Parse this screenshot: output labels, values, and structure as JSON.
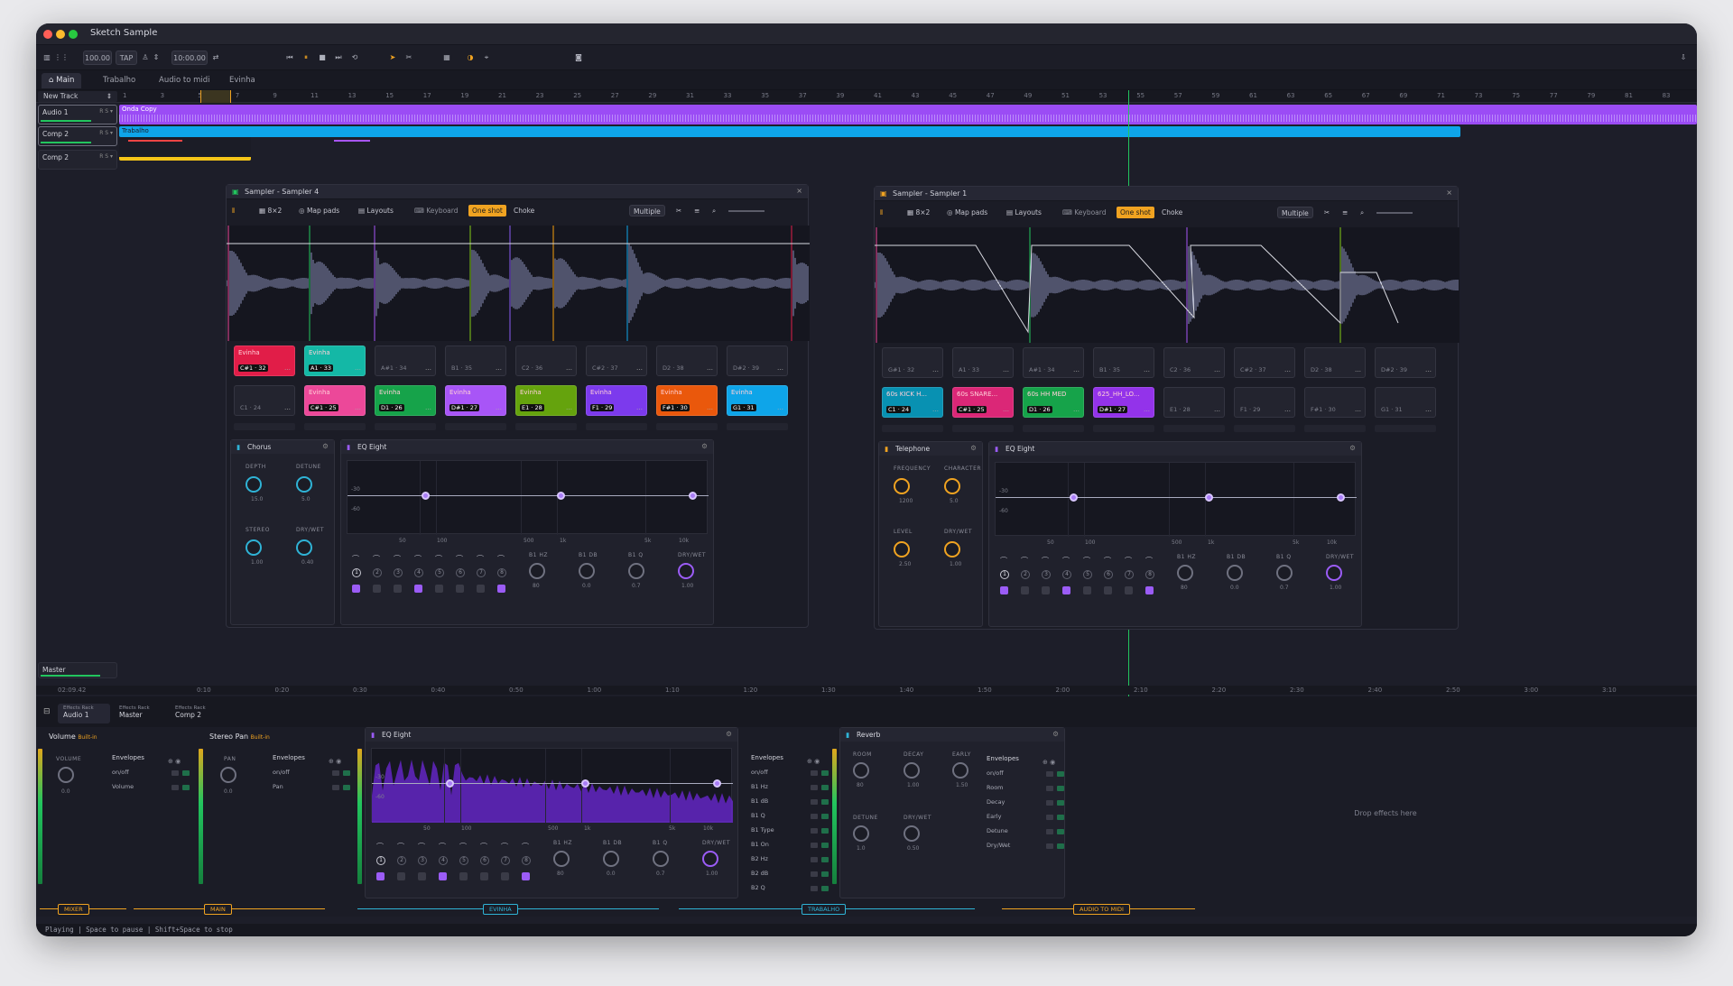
{
  "app_title": "Sketch Sample",
  "toolbar": {
    "bpm": "100.00",
    "tap": "TAP",
    "time": "10:00.00"
  },
  "tabs": [
    "Main",
    "Trabalho",
    "Audio to midi",
    "Evinha"
  ],
  "new_track": "New Track",
  "ruler_numbers": [
    "1",
    "3",
    "5",
    "7",
    "9",
    "11",
    "13",
    "15",
    "17",
    "19",
    "21",
    "23",
    "25",
    "27",
    "29",
    "31",
    "33",
    "35",
    "37",
    "39",
    "41",
    "43",
    "45",
    "47",
    "49",
    "51",
    "53",
    "55",
    "57",
    "59",
    "61",
    "63",
    "65",
    "67",
    "69",
    "71",
    "73",
    "75",
    "77",
    "79",
    "81",
    "83"
  ],
  "tracks": [
    {
      "name": "Audio 1",
      "clip": "Onda Copy",
      "color": "#a855f7"
    },
    {
      "name": "Comp 2",
      "clip": "Trabalho",
      "color": "#0ea5e9"
    },
    {
      "name": "Comp 2",
      "clip": "Audio to midi",
      "color": "#f5c518"
    }
  ],
  "master_track": "Master",
  "sampler_left": {
    "title": "Sampler - Sampler 4",
    "toolbar": {
      "grid": "8×2",
      "map_pads": "Map pads",
      "layouts": "Layouts",
      "keyboard": "Keyboard",
      "one_shot": "One shot",
      "choke": "Choke",
      "multiple": "Multiple"
    },
    "pads_top": [
      {
        "name": "Evinha",
        "note": "C#1 · 32",
        "color": "#e11d48"
      },
      {
        "name": "Evinha",
        "note": "A1 · 33",
        "color": "#14b8a6"
      },
      {
        "name": "",
        "note": "A#1 · 34",
        "color": ""
      },
      {
        "name": "",
        "note": "B1 · 35",
        "color": ""
      },
      {
        "name": "",
        "note": "C2 · 36",
        "color": ""
      },
      {
        "name": "",
        "note": "C#2 · 37",
        "color": ""
      },
      {
        "name": "",
        "note": "D2 · 38",
        "color": ""
      },
      {
        "name": "",
        "note": "D#2 · 39",
        "color": ""
      }
    ],
    "pads_bottom": [
      {
        "name": "",
        "note": "C1 · 24",
        "color": ""
      },
      {
        "name": "Evinha",
        "note": "C#1 · 25",
        "color": "#ec4899"
      },
      {
        "name": "Evinha",
        "note": "D1 · 26",
        "color": "#16a34a"
      },
      {
        "name": "Evinha",
        "note": "D#1 · 27",
        "color": "#a855f7"
      },
      {
        "name": "Evinha",
        "note": "E1 · 28",
        "color": "#65a30d"
      },
      {
        "name": "Evinha",
        "note": "F1 · 29",
        "color": "#7c3aed"
      },
      {
        "name": "Evinha",
        "note": "F#1 · 30",
        "color": "#ea580c"
      },
      {
        "name": "Evinha",
        "note": "G1 · 31",
        "color": "#0ea5e9"
      }
    ],
    "fx1": {
      "name": "Chorus",
      "knobs": [
        {
          "label": "DEPTH",
          "value": "15.0"
        },
        {
          "label": "DETUNE",
          "value": "5.0"
        },
        {
          "label": "STEREO",
          "value": "1.00"
        },
        {
          "label": "DRY/WET",
          "value": "0.40"
        }
      ]
    },
    "fx2": {
      "name": "EQ Eight"
    }
  },
  "sampler_right": {
    "title": "Sampler - Sampler 1",
    "toolbar": {
      "grid": "8×2",
      "map_pads": "Map pads",
      "layouts": "Layouts",
      "keyboard": "Keyboard",
      "one_shot": "One shot",
      "choke": "Choke",
      "multiple": "Multiple"
    },
    "pads_top": [
      {
        "name": "",
        "note": "G#1 · 32",
        "color": ""
      },
      {
        "name": "",
        "note": "A1 · 33",
        "color": ""
      },
      {
        "name": "",
        "note": "A#1 · 34",
        "color": ""
      },
      {
        "name": "",
        "note": "B1 · 35",
        "color": ""
      },
      {
        "name": "",
        "note": "C2 · 36",
        "color": ""
      },
      {
        "name": "",
        "note": "C#2 · 37",
        "color": ""
      },
      {
        "name": "",
        "note": "D2 · 38",
        "color": ""
      },
      {
        "name": "",
        "note": "D#2 · 39",
        "color": ""
      }
    ],
    "pads_bottom": [
      {
        "name": "60s KICK H...",
        "note": "C1 · 24",
        "color": "#0891b2"
      },
      {
        "name": "60s SNARE...",
        "note": "C#1 · 25",
        "color": "#db2777"
      },
      {
        "name": "60s HH MED",
        "note": "D1 · 26",
        "color": "#16a34a"
      },
      {
        "name": "625_HH_LO...",
        "note": "D#1 · 27",
        "color": "#9333ea"
      },
      {
        "name": "",
        "note": "E1 · 28",
        "color": ""
      },
      {
        "name": "",
        "note": "F1 · 29",
        "color": ""
      },
      {
        "name": "",
        "note": "F#1 · 30",
        "color": ""
      },
      {
        "name": "",
        "note": "G1 · 31",
        "color": ""
      }
    ],
    "fx1": {
      "name": "Telephone",
      "knobs": [
        {
          "label": "FREQUENCY",
          "value": "1200"
        },
        {
          "label": "CHARACTER",
          "value": "5.0"
        },
        {
          "label": "LEVEL",
          "value": "2.50"
        },
        {
          "label": "DRY/WET",
          "value": "1.00"
        }
      ]
    },
    "fx2": {
      "name": "EQ Eight"
    }
  },
  "eq": {
    "db_labels": [
      "-30",
      "-60"
    ],
    "freq_labels": [
      "50",
      "100",
      "500",
      "1k",
      "5k",
      "10k"
    ],
    "knobs": [
      {
        "label": "B1 HZ",
        "value": "80"
      },
      {
        "label": "B1 DB",
        "value": "0.0"
      },
      {
        "label": "B1 Q",
        "value": "0.7"
      },
      {
        "label": "DRY/WET",
        "value": "1.00"
      }
    ],
    "bands": [
      "1",
      "2",
      "3",
      "4",
      "5",
      "6",
      "7",
      "8"
    ],
    "bands_on": [
      true,
      false,
      false,
      true,
      false,
      false,
      false,
      true
    ]
  },
  "arrangement_time": "02:09.42",
  "time_ruler": [
    "0:10",
    "0:20",
    "0:30",
    "0:40",
    "0:50",
    "1:00",
    "1:10",
    "1:20",
    "1:30",
    "1:40",
    "1:50",
    "2:00",
    "2:10",
    "2:20",
    "2:30",
    "2:40",
    "2:50",
    "3:00",
    "3:10"
  ],
  "effects_tabs": [
    {
      "top": "Effects Rack",
      "name": "Audio 1"
    },
    {
      "top": "Effects Rack",
      "name": "Master"
    },
    {
      "top": "Effects Rack",
      "name": "Comp 2"
    }
  ],
  "bottom": {
    "volume": {
      "name": "Volume",
      "badge": "Built-in",
      "knob_label": "VOLUME",
      "knob_value": "0.0",
      "env_title": "Envelopes",
      "env": [
        "on/off",
        "Volume"
      ]
    },
    "pan": {
      "name": "Stereo Pan",
      "badge": "Built-in",
      "knob_label": "PAN",
      "knob_value": "0.0",
      "env_title": "Envelopes",
      "env": [
        "on/off",
        "Pan"
      ]
    },
    "eq": {
      "name": "EQ Eight",
      "env_title": "Envelopes",
      "env": [
        "on/off",
        "B1 Hz",
        "B1 dB",
        "B1 Q",
        "B1 Type",
        "B1 On",
        "B2 Hz",
        "B2 dB",
        "B2 Q"
      ]
    },
    "reverb": {
      "name": "Reverb",
      "knobs": [
        {
          "label": "ROOM",
          "value": "80"
        },
        {
          "label": "DECAY",
          "value": "1.00"
        },
        {
          "label": "EARLY",
          "value": "1.50"
        },
        {
          "label": "DETUNE",
          "value": "1.0"
        },
        {
          "label": "DRY/WET",
          "value": "0.50"
        }
      ],
      "env_title": "Envelopes",
      "env": [
        "on/off",
        "Room",
        "Decay",
        "Early",
        "Detune",
        "Dry/Wet"
      ]
    },
    "drop": "Drop effects here"
  },
  "navigator": [
    {
      "label": "MIXER",
      "color": "#f0a321"
    },
    {
      "label": "MAIN",
      "color": "#f0a321"
    },
    {
      "label": "EVINHA",
      "color": "#2fb3d6"
    },
    {
      "label": "TRABALHO",
      "color": "#2fb3d6"
    },
    {
      "label": "AUDIO TO MIDI",
      "color": "#f0a321"
    }
  ],
  "status": "Playing | Space to pause | Shift+Space to stop"
}
